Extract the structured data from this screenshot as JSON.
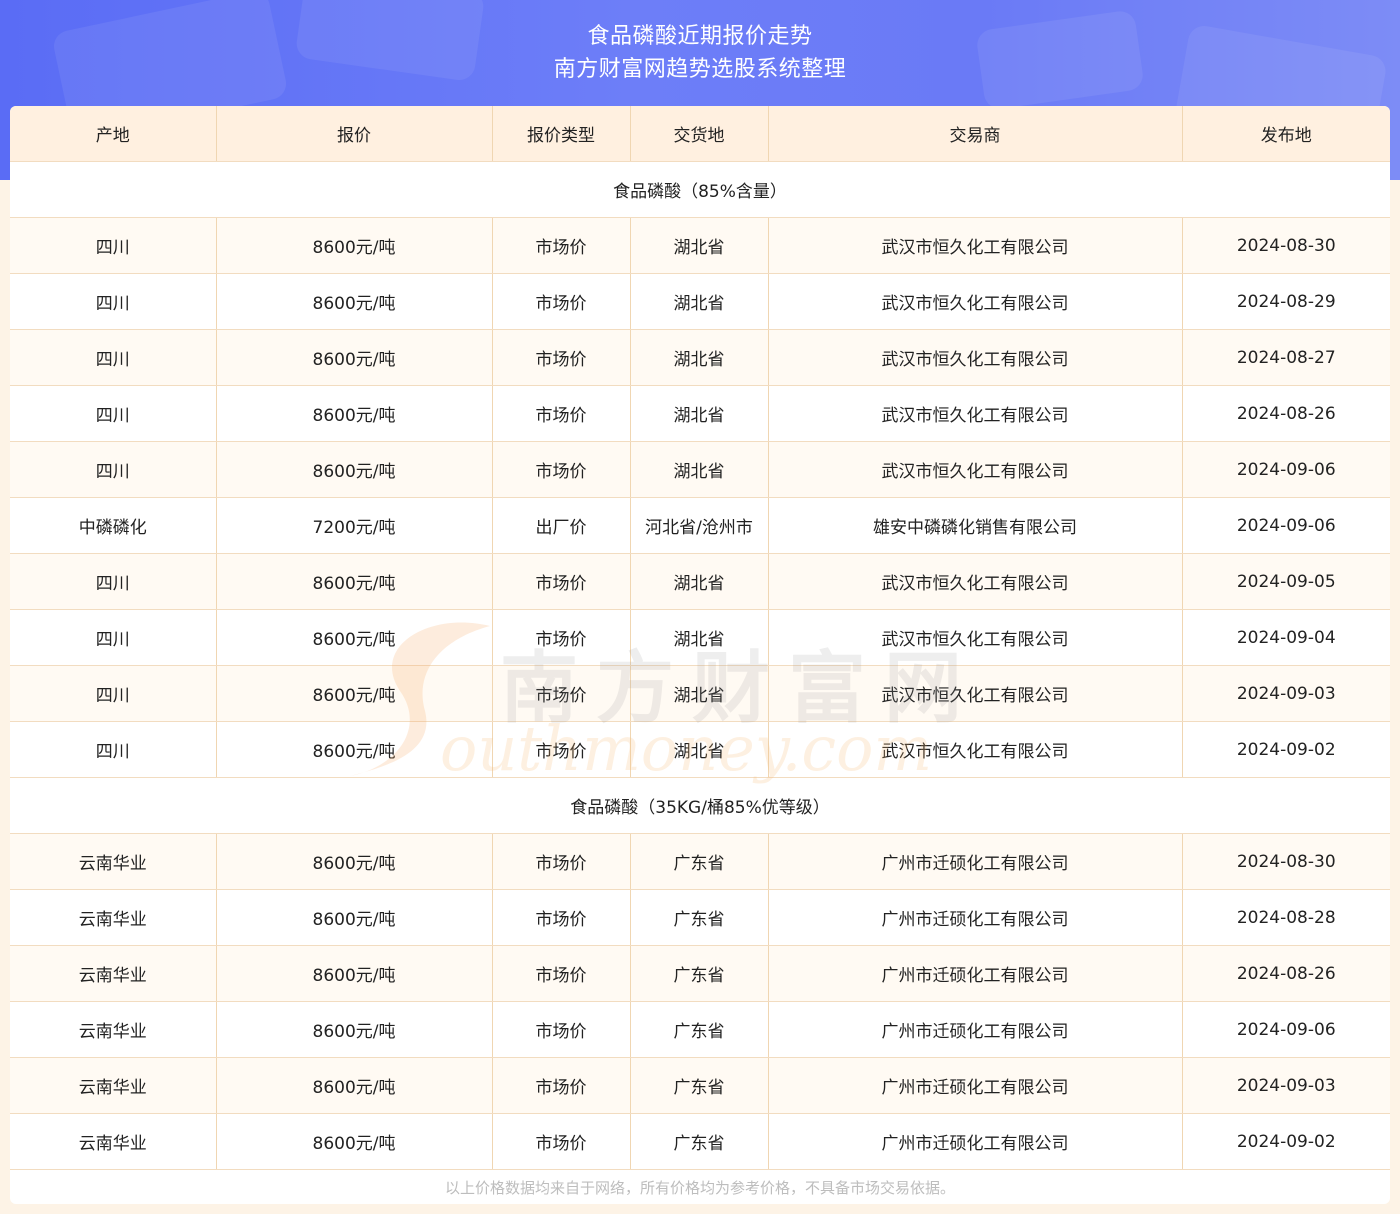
{
  "header": {
    "title": "食品磷酸近期报价走势",
    "subtitle": "南方财富网趋势选股系统整理"
  },
  "table": {
    "columns": [
      "产地",
      "报价",
      "报价类型",
      "交货地",
      "交易商",
      "发布地"
    ],
    "groups": [
      {
        "title": "食品磷酸（85%含量）",
        "rows": [
          [
            "四川",
            "8600元/吨",
            "市场价",
            "湖北省",
            "武汉市恒久化工有限公司",
            "2024-08-30"
          ],
          [
            "四川",
            "8600元/吨",
            "市场价",
            "湖北省",
            "武汉市恒久化工有限公司",
            "2024-08-29"
          ],
          [
            "四川",
            "8600元/吨",
            "市场价",
            "湖北省",
            "武汉市恒久化工有限公司",
            "2024-08-27"
          ],
          [
            "四川",
            "8600元/吨",
            "市场价",
            "湖北省",
            "武汉市恒久化工有限公司",
            "2024-08-26"
          ],
          [
            "四川",
            "8600元/吨",
            "市场价",
            "湖北省",
            "武汉市恒久化工有限公司",
            "2024-09-06"
          ],
          [
            "中磷磷化",
            "7200元/吨",
            "出厂价",
            "河北省/沧州市",
            "雄安中磷磷化销售有限公司",
            "2024-09-06"
          ],
          [
            "四川",
            "8600元/吨",
            "市场价",
            "湖北省",
            "武汉市恒久化工有限公司",
            "2024-09-05"
          ],
          [
            "四川",
            "8600元/吨",
            "市场价",
            "湖北省",
            "武汉市恒久化工有限公司",
            "2024-09-04"
          ],
          [
            "四川",
            "8600元/吨",
            "市场价",
            "湖北省",
            "武汉市恒久化工有限公司",
            "2024-09-03"
          ],
          [
            "四川",
            "8600元/吨",
            "市场价",
            "湖北省",
            "武汉市恒久化工有限公司",
            "2024-09-02"
          ]
        ]
      },
      {
        "title": "食品磷酸（35KG/桶85%优等级）",
        "rows": [
          [
            "云南华业",
            "8600元/吨",
            "市场价",
            "广东省",
            "广州市迁硕化工有限公司",
            "2024-08-30"
          ],
          [
            "云南华业",
            "8600元/吨",
            "市场价",
            "广东省",
            "广州市迁硕化工有限公司",
            "2024-08-28"
          ],
          [
            "云南华业",
            "8600元/吨",
            "市场价",
            "广东省",
            "广州市迁硕化工有限公司",
            "2024-08-26"
          ],
          [
            "云南华业",
            "8600元/吨",
            "市场价",
            "广东省",
            "广州市迁硕化工有限公司",
            "2024-09-06"
          ],
          [
            "云南华业",
            "8600元/吨",
            "市场价",
            "广东省",
            "广州市迁硕化工有限公司",
            "2024-09-03"
          ],
          [
            "云南华业",
            "8600元/吨",
            "市场价",
            "广东省",
            "广州市迁硕化工有限公司",
            "2024-09-02"
          ]
        ]
      }
    ]
  },
  "watermark": {
    "cn": "南方财富网",
    "en": "outhmoney.com"
  },
  "footer": {
    "note": "以上价格数据均来自于网络，所有价格均为参考价格，不具备市场交易依据。"
  }
}
